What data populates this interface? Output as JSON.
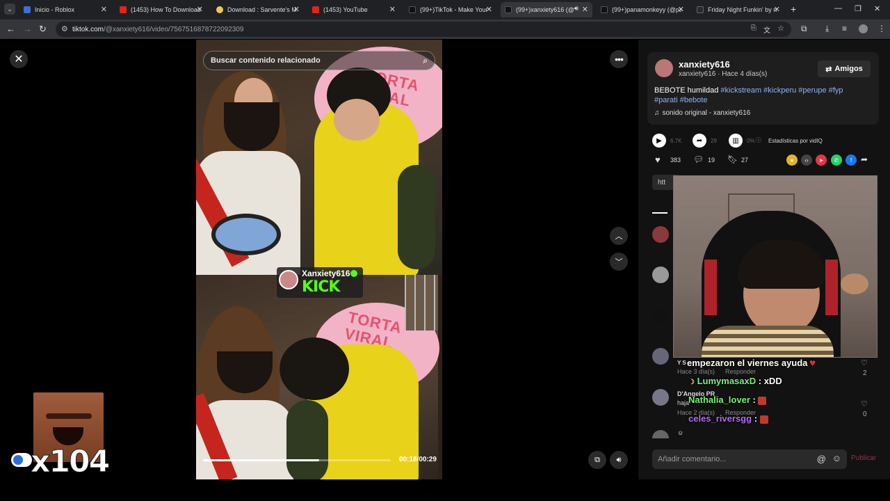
{
  "browser": {
    "tabs": [
      {
        "title": "Inicio - Roblox",
        "favicon_color": "#3b6fd6"
      },
      {
        "title": "(1453) How To Download",
        "favicon_color": "#e62117"
      },
      {
        "title": "Download : Sarvente's M",
        "favicon_color": "#f2c94c"
      },
      {
        "title": "(1453) YouTube",
        "favicon_color": "#e62117"
      },
      {
        "title": "(99+)TikTok - Make Your",
        "favicon_color": "#111111"
      },
      {
        "title": "(99+)xanxiety616 (@",
        "favicon_color": "#111111"
      },
      {
        "title": "(99+)panamonkeyy (@pa",
        "favicon_color": "#111111"
      },
      {
        "title": "Friday Night Funkin' by n",
        "favicon_color": "#2a2a2a"
      }
    ],
    "url_host": "tiktok.com",
    "url_path": "/@xanxiety616/video/7567516878722092309"
  },
  "player": {
    "search_placeholder": "Buscar contenido relacionado",
    "badge_name": "Xanxiety616",
    "badge_brand": "KICK",
    "cake_text": "TORTA VIRAL",
    "timecode": "00:18/00:29",
    "progress_fraction": 0.62
  },
  "overlay": {
    "emote_count": "x104"
  },
  "post": {
    "author_name": "xanxiety616",
    "author_meta": "xanxiety616 · Hace 4 días(s)",
    "friends_label": "Amigos",
    "caption_text": "BEBOTE humildad",
    "caption_tags": [
      "#kickstream",
      "#kickperu",
      "#perupe",
      "#fyp",
      "#parati",
      "#bebote"
    ],
    "sound": "sonido original - xanxiety616",
    "stats_views": "6.7K",
    "stats_shares": "29",
    "stats_pct": "0%",
    "stats_label": "Estadísticas por vidIQ",
    "likes": "383",
    "comments": "19",
    "saves": "27",
    "url_chip": "htt"
  },
  "comments": [
    {
      "name": "",
      "meta_line": "Hace 3 día(s)",
      "reply": "Responder",
      "like_count": "2",
      "prefix": "Y S"
    },
    {
      "name": "D'Angelo PR",
      "text": "haja",
      "meta_line": "Hace 2 día(s)",
      "reply": "Responder",
      "like_count": "0"
    }
  ],
  "chat": [
    {
      "user": "",
      "message": "empezaron el viernes ayuda",
      "color": "#ffffff"
    },
    {
      "user": "LumymasaxD",
      "message": ": xDD",
      "color": "#7cf27c"
    },
    {
      "user": "Nathalia_lover",
      "message": ":",
      "color": "#7cf27c"
    },
    {
      "user": "celes_riversgg",
      "message": ":",
      "color": "#b36bf2"
    }
  ],
  "composer": {
    "placeholder": "Añadir comentario...",
    "post_label": "Publicar"
  },
  "colors": {
    "accent_green": "#53fc18",
    "tag_blue": "#8ab4f8"
  }
}
